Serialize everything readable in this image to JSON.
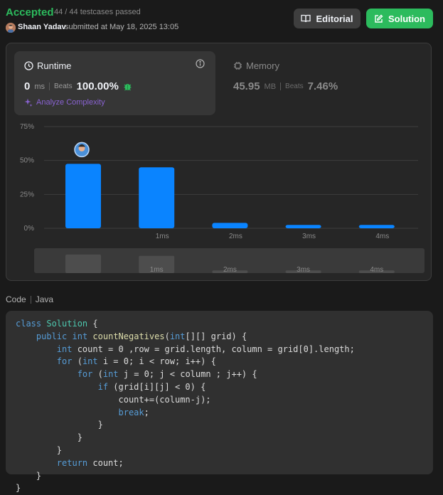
{
  "status": {
    "title": "Accepted",
    "testcases": "44 / 44 testcases passed"
  },
  "submission": {
    "user": "Shaan Yadav",
    "meta": "submitted at May 18, 2025 13:05"
  },
  "buttons": {
    "editorial": "Editorial",
    "solution": "Solution"
  },
  "runtime": {
    "label": "Runtime",
    "value": "0",
    "unit": "ms",
    "beats_label": "Beats",
    "beats": "100.00%",
    "analyze": "Analyze Complexity"
  },
  "memory": {
    "label": "Memory",
    "value": "45.95",
    "unit": "MB",
    "beats_label": "Beats",
    "beats": "7.46%"
  },
  "code": {
    "label": "Code",
    "language": "Java"
  },
  "colors": {
    "accent": "#2cbb5d",
    "bar": "#0a84ff",
    "panel": "#262626",
    "card": "#363636",
    "analyze": "#8a63d2"
  },
  "icons": {
    "info": "info-icon",
    "clock": "clock-icon",
    "chip": "chip-icon",
    "sparkle": "sparkle-icon",
    "book": "book-icon",
    "edit": "edit-icon",
    "bug": "bug-icon"
  },
  "chart_data": {
    "type": "bar",
    "categories": [
      "",
      "1ms",
      "2ms",
      "3ms",
      "4ms"
    ],
    "values": [
      47.5,
      45,
      4,
      2.5,
      2.5
    ],
    "y_ticks": [
      "0%",
      "25%",
      "50%",
      "75%"
    ],
    "ylim": [
      0,
      75
    ],
    "grid": true,
    "highlight_index": 0,
    "overview_values": [
      14,
      13,
      2,
      2,
      2
    ]
  }
}
